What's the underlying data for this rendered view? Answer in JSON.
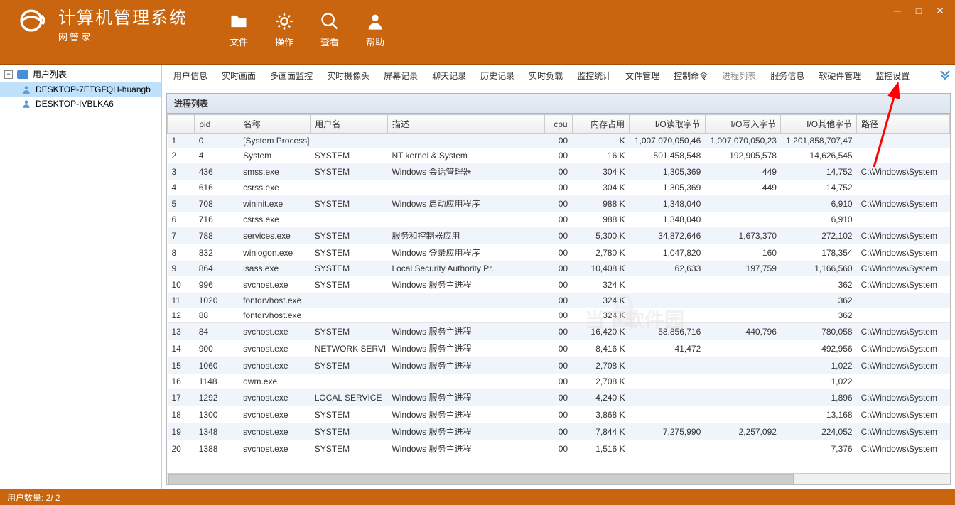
{
  "app": {
    "title": "计算机管理系统",
    "brand": "网管家"
  },
  "toolbar": [
    {
      "id": "file",
      "label": "文件"
    },
    {
      "id": "action",
      "label": "操作"
    },
    {
      "id": "view",
      "label": "查看"
    },
    {
      "id": "help",
      "label": "帮助"
    }
  ],
  "sidebar": {
    "root": "用户列表",
    "items": [
      {
        "label": "DESKTOP-7ETGFQH-huangb",
        "selected": true
      },
      {
        "label": "DESKTOP-IVBLKA6",
        "selected": false
      }
    ]
  },
  "tabs": [
    "用户信息",
    "实时画面",
    "多画面监控",
    "实时摄像头",
    "屏幕记录",
    "聊天记录",
    "历史记录",
    "实时负载",
    "监控统计",
    "文件管理",
    "控制命令",
    "进程列表",
    "服务信息",
    "软硬件管理",
    "监控设置"
  ],
  "active_tab": 11,
  "panel_title": "进程列表",
  "columns": [
    "",
    "pid",
    "名称",
    "用户名",
    "描述",
    "cpu",
    "内存占用",
    "I/O读取字节",
    "I/O写入字节",
    "I/O其他字节",
    "路径"
  ],
  "rows": [
    {
      "n": "1",
      "pid": "0",
      "name": "[System Process]",
      "user": "",
      "desc": "",
      "cpu": "00",
      "mem": "K",
      "io1": "1,007,070,050,46",
      "io2": "1,007,070,050,23",
      "io3": "1,201,858,707,47",
      "path": ""
    },
    {
      "n": "2",
      "pid": "4",
      "name": "System",
      "user": "SYSTEM",
      "desc": "NT kernel & System",
      "cpu": "00",
      "mem": "16 K",
      "io1": "501,458,548",
      "io2": "192,905,578",
      "io3": "14,626,545",
      "path": ""
    },
    {
      "n": "3",
      "pid": "436",
      "name": "smss.exe",
      "user": "SYSTEM",
      "desc": "Windows 会话管理器",
      "cpu": "00",
      "mem": "304 K",
      "io1": "1,305,369",
      "io2": "449",
      "io3": "14,752",
      "path": "C:\\Windows\\System"
    },
    {
      "n": "4",
      "pid": "616",
      "name": "csrss.exe",
      "user": "",
      "desc": "",
      "cpu": "00",
      "mem": "304 K",
      "io1": "1,305,369",
      "io2": "449",
      "io3": "14,752",
      "path": ""
    },
    {
      "n": "5",
      "pid": "708",
      "name": "wininit.exe",
      "user": "SYSTEM",
      "desc": "Windows 启动应用程序",
      "cpu": "00",
      "mem": "988 K",
      "io1": "1,348,040",
      "io2": "",
      "io3": "6,910",
      "path": "C:\\Windows\\System"
    },
    {
      "n": "6",
      "pid": "716",
      "name": "csrss.exe",
      "user": "",
      "desc": "",
      "cpu": "00",
      "mem": "988 K",
      "io1": "1,348,040",
      "io2": "",
      "io3": "6,910",
      "path": ""
    },
    {
      "n": "7",
      "pid": "788",
      "name": "services.exe",
      "user": "SYSTEM",
      "desc": "服务和控制器应用",
      "cpu": "00",
      "mem": "5,300 K",
      "io1": "34,872,646",
      "io2": "1,673,370",
      "io3": "272,102",
      "path": "C:\\Windows\\System"
    },
    {
      "n": "8",
      "pid": "832",
      "name": "winlogon.exe",
      "user": "SYSTEM",
      "desc": "Windows 登录应用程序",
      "cpu": "00",
      "mem": "2,780 K",
      "io1": "1,047,820",
      "io2": "160",
      "io3": "178,354",
      "path": "C:\\Windows\\System"
    },
    {
      "n": "9",
      "pid": "864",
      "name": "lsass.exe",
      "user": "SYSTEM",
      "desc": "Local Security Authority Pr...",
      "cpu": "00",
      "mem": "10,408 K",
      "io1": "62,633",
      "io2": "197,759",
      "io3": "1,166,560",
      "path": "C:\\Windows\\System"
    },
    {
      "n": "10",
      "pid": "996",
      "name": "svchost.exe",
      "user": "SYSTEM",
      "desc": "Windows 服务主进程",
      "cpu": "00",
      "mem": "324 K",
      "io1": "",
      "io2": "",
      "io3": "362",
      "path": "C:\\Windows\\System"
    },
    {
      "n": "11",
      "pid": "1020",
      "name": "fontdrvhost.exe",
      "user": "",
      "desc": "",
      "cpu": "00",
      "mem": "324 K",
      "io1": "",
      "io2": "",
      "io3": "362",
      "path": ""
    },
    {
      "n": "12",
      "pid": "88",
      "name": "fontdrvhost.exe",
      "user": "",
      "desc": "",
      "cpu": "00",
      "mem": "324 K",
      "io1": "",
      "io2": "",
      "io3": "362",
      "path": ""
    },
    {
      "n": "13",
      "pid": "84",
      "name": "svchost.exe",
      "user": "SYSTEM",
      "desc": "Windows 服务主进程",
      "cpu": "00",
      "mem": "16,420 K",
      "io1": "58,856,716",
      "io2": "440,796",
      "io3": "780,058",
      "path": "C:\\Windows\\System"
    },
    {
      "n": "14",
      "pid": "900",
      "name": "svchost.exe",
      "user": "NETWORK SERVI",
      "desc": "Windows 服务主进程",
      "cpu": "00",
      "mem": "8,416 K",
      "io1": "41,472",
      "io2": "",
      "io3": "492,956",
      "path": "C:\\Windows\\System"
    },
    {
      "n": "15",
      "pid": "1060",
      "name": "svchost.exe",
      "user": "SYSTEM",
      "desc": "Windows 服务主进程",
      "cpu": "00",
      "mem": "2,708 K",
      "io1": "",
      "io2": "",
      "io3": "1,022",
      "path": "C:\\Windows\\System"
    },
    {
      "n": "16",
      "pid": "1148",
      "name": "dwm.exe",
      "user": "",
      "desc": "",
      "cpu": "00",
      "mem": "2,708 K",
      "io1": "",
      "io2": "",
      "io3": "1,022",
      "path": ""
    },
    {
      "n": "17",
      "pid": "1292",
      "name": "svchost.exe",
      "user": "LOCAL SERVICE",
      "desc": "Windows 服务主进程",
      "cpu": "00",
      "mem": "4,240 K",
      "io1": "",
      "io2": "",
      "io3": "1,896",
      "path": "C:\\Windows\\System"
    },
    {
      "n": "18",
      "pid": "1300",
      "name": "svchost.exe",
      "user": "SYSTEM",
      "desc": "Windows 服务主进程",
      "cpu": "00",
      "mem": "3,868 K",
      "io1": "",
      "io2": "",
      "io3": "13,168",
      "path": "C:\\Windows\\System"
    },
    {
      "n": "19",
      "pid": "1348",
      "name": "svchost.exe",
      "user": "SYSTEM",
      "desc": "Windows 服务主进程",
      "cpu": "00",
      "mem": "7,844 K",
      "io1": "7,275,990",
      "io2": "2,257,092",
      "io3": "224,052",
      "path": "C:\\Windows\\System"
    },
    {
      "n": "20",
      "pid": "1388",
      "name": "svchost.exe",
      "user": "SYSTEM",
      "desc": "Windows 服务主进程",
      "cpu": "00",
      "mem": "1,516 K",
      "io1": "",
      "io2": "",
      "io3": "7,376",
      "path": "C:\\Windows\\System"
    }
  ],
  "status": "用户数量: 2/ 2"
}
